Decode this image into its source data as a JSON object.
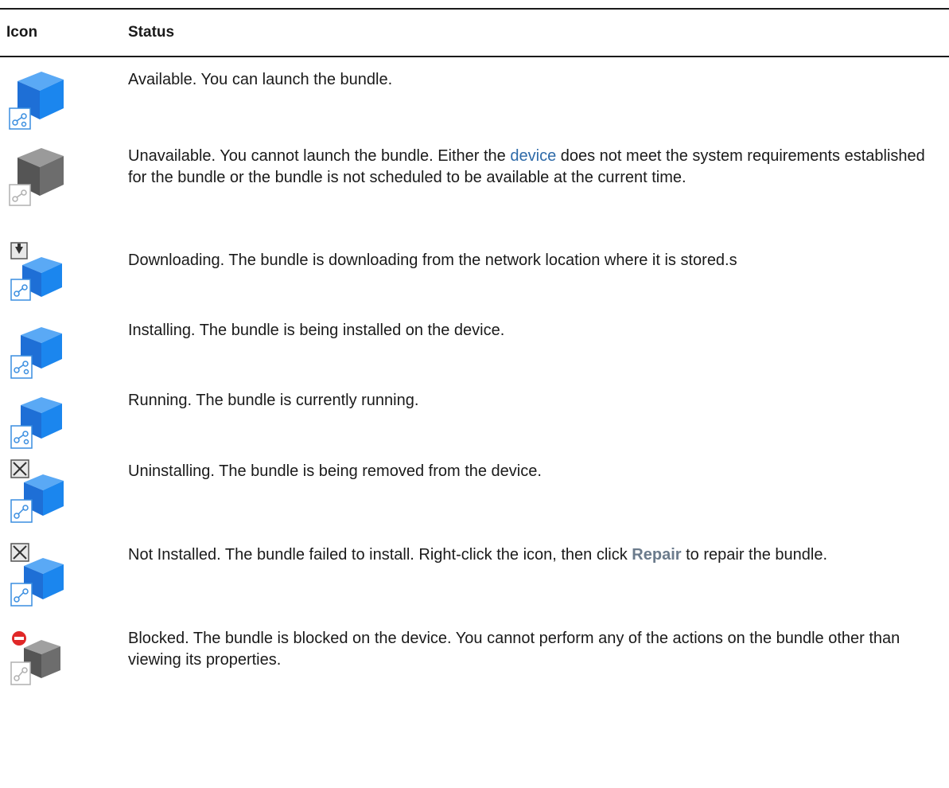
{
  "header": {
    "icon": "Icon",
    "status": "Status"
  },
  "rows": [
    {
      "icon": "bundle-available-icon",
      "text": "Available. You can launch the bundle."
    },
    {
      "icon": "bundle-unavailable-icon",
      "pre": "Unavailable. You cannot launch the bundle. Either the ",
      "link": "device",
      "post": " does not meet the system requirements established for the bundle or the bundle is not scheduled to be available at the current time."
    },
    {
      "icon": "bundle-downloading-icon",
      "text": "Downloading. The bundle is downloading from the network location where it is stored.s"
    },
    {
      "icon": "bundle-installing-icon",
      "text": "Installing. The bundle is being installed on the device."
    },
    {
      "icon": "bundle-running-icon",
      "text": "Running. The bundle is currently running."
    },
    {
      "icon": "bundle-uninstalling-icon",
      "text": "Uninstalling. The bundle is being removed from the device."
    },
    {
      "icon": "bundle-not-installed-icon",
      "pre": "Not Installed. The bundle failed to install. Right-click the icon, then click ",
      "bold": "Repair",
      "post": " to repair the bundle."
    },
    {
      "icon": "bundle-blocked-icon",
      "text": "Blocked. The bundle is blocked on the device. You cannot perform any of the actions on the bundle other than viewing its properties."
    }
  ],
  "colors": {
    "blue": "#1e7ae0",
    "gray": "#6d6d6d",
    "link": "#2e6aa8"
  }
}
